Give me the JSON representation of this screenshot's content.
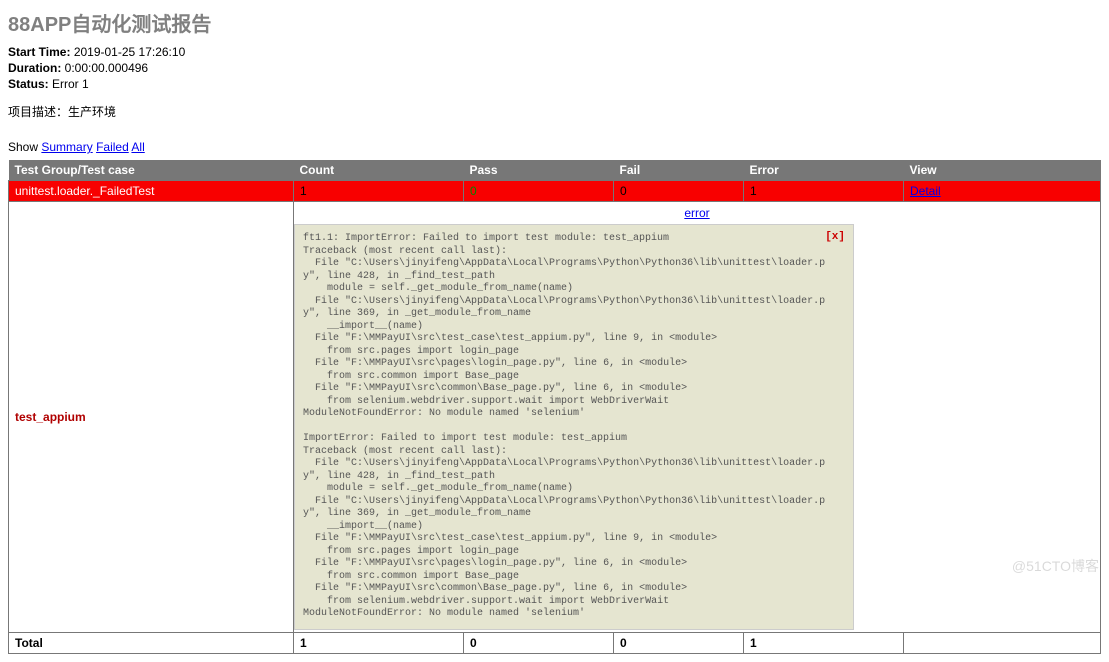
{
  "title": "88APP自动化测试报告",
  "meta": {
    "start_label": "Start Time:",
    "start_value": "2019-01-25 17:26:10",
    "duration_label": "Duration:",
    "duration_value": "0:00:00.000496",
    "status_label": "Status:",
    "status_value": "Error 1"
  },
  "desc_line": "项目描述：生产环境",
  "show": {
    "label": "Show",
    "summary": "Summary",
    "failed": "Failed",
    "all": "All"
  },
  "headers": {
    "group": "Test Group/Test case",
    "count": "Count",
    "pass": "Pass",
    "fail": "Fail",
    "error": "Error",
    "view": "View"
  },
  "group_row": {
    "name": "unittest.loader._FailedTest",
    "count": "1",
    "pass": "0",
    "fail": "0",
    "error": "1",
    "detail": "Detail"
  },
  "case": {
    "name": "test_appium",
    "error_link": "error",
    "close": "[x]",
    "traceback": "ft1.1: ImportError: Failed to import test module: test_appium\nTraceback (most recent call last):\n  File \"C:\\Users\\jinyifeng\\AppData\\Local\\Programs\\Python\\Python36\\lib\\unittest\\loader.py\", line 428, in _find_test_path\n    module = self._get_module_from_name(name)\n  File \"C:\\Users\\jinyifeng\\AppData\\Local\\Programs\\Python\\Python36\\lib\\unittest\\loader.py\", line 369, in _get_module_from_name\n    __import__(name)\n  File \"F:\\MMPayUI\\src\\test_case\\test_appium.py\", line 9, in <module>\n    from src.pages import login_page\n  File \"F:\\MMPayUI\\src\\pages\\login_page.py\", line 6, in <module>\n    from src.common import Base_page\n  File \"F:\\MMPayUI\\src\\common\\Base_page.py\", line 6, in <module>\n    from selenium.webdriver.support.wait import WebDriverWait\nModuleNotFoundError: No module named 'selenium'\n\nImportError: Failed to import test module: test_appium\nTraceback (most recent call last):\n  File \"C:\\Users\\jinyifeng\\AppData\\Local\\Programs\\Python\\Python36\\lib\\unittest\\loader.py\", line 428, in _find_test_path\n    module = self._get_module_from_name(name)\n  File \"C:\\Users\\jinyifeng\\AppData\\Local\\Programs\\Python\\Python36\\lib\\unittest\\loader.py\", line 369, in _get_module_from_name\n    __import__(name)\n  File \"F:\\MMPayUI\\src\\test_case\\test_appium.py\", line 9, in <module>\n    from src.pages import login_page\n  File \"F:\\MMPayUI\\src\\pages\\login_page.py\", line 6, in <module>\n    from src.common import Base_page\n  File \"F:\\MMPayUI\\src\\common\\Base_page.py\", line 6, in <module>\n    from selenium.webdriver.support.wait import WebDriverWait\nModuleNotFoundError: No module named 'selenium'"
  },
  "totals": {
    "label": "Total",
    "count": "1",
    "pass": "0",
    "fail": "0",
    "error": "1",
    "view": ""
  },
  "watermark": "@51CTO博客"
}
